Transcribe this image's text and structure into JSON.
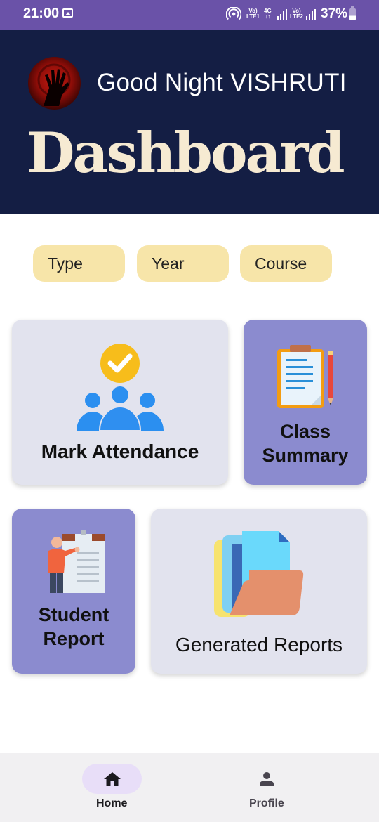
{
  "status_bar": {
    "time": "21:00",
    "volte1_top": "Vo)",
    "volte1_bottom": "LTE1",
    "network_top": "4G",
    "network_bottom": "↓↑",
    "volte2_top": "Vo)",
    "volte2_bottom": "LTE2",
    "battery": "37%",
    "battery_level": 0.37
  },
  "header": {
    "greeting": "Good Night VISHRUTI",
    "title": "Dashboard"
  },
  "filters": {
    "type": "Type",
    "year": "Year",
    "course": "Course"
  },
  "cards": {
    "mark_attendance": "Mark Attendance",
    "class_summary_line1": "Class",
    "class_summary_line2": "Summary",
    "student_report_line1": "Student",
    "student_report_line2": "Report",
    "generated_reports": "Generated Reports"
  },
  "bottom_nav": {
    "home": "Home",
    "profile": "Profile"
  },
  "colors": {
    "status_bar": "#6a52a8",
    "header_bg": "#141e44",
    "title": "#f6ead2",
    "filter_chip": "#f7e5a9",
    "card_light": "#e2e3ee",
    "card_purple": "#8b8bcf",
    "nav_active_pill": "#e8def8"
  },
  "icons": {
    "gallery": "image-icon",
    "hotspot": "hotspot-icon",
    "home": "home-icon",
    "profile": "person-icon"
  }
}
